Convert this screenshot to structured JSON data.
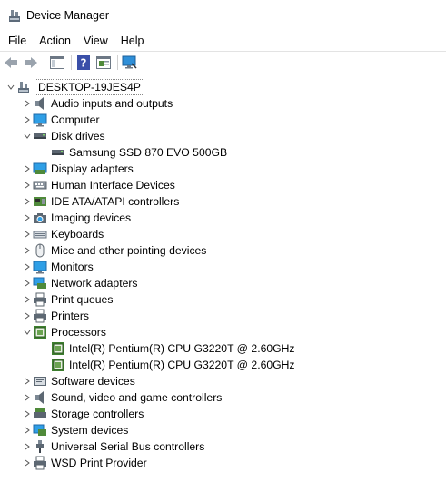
{
  "window": {
    "title": "Device Manager"
  },
  "menu": [
    "File",
    "Action",
    "View",
    "Help"
  ],
  "toolbar": [
    "back-icon",
    "forward-icon",
    "show-hide-console-tree-icon",
    "help-icon",
    "properties-icon",
    "scan-hardware-icon"
  ],
  "tree": {
    "root": "DESKTOP-19JES4P",
    "categories": [
      {
        "label": "Audio inputs and outputs",
        "icon": "speaker-icon",
        "expanded": false
      },
      {
        "label": "Computer",
        "icon": "monitor-icon",
        "expanded": false
      },
      {
        "label": "Disk drives",
        "icon": "disk-drive-icon",
        "expanded": true,
        "children": [
          "Samsung SSD 870 EVO 500GB"
        ]
      },
      {
        "label": "Display adapters",
        "icon": "display-adapter-icon",
        "expanded": false
      },
      {
        "label": "Human Interface Devices",
        "icon": "hid-icon",
        "expanded": false
      },
      {
        "label": "IDE ATA/ATAPI controllers",
        "icon": "ide-controller-icon",
        "expanded": false
      },
      {
        "label": "Imaging devices",
        "icon": "camera-icon",
        "expanded": false
      },
      {
        "label": "Keyboards",
        "icon": "keyboard-icon",
        "expanded": false
      },
      {
        "label": "Mice and other pointing devices",
        "icon": "mouse-icon",
        "expanded": false
      },
      {
        "label": "Monitors",
        "icon": "monitor-icon",
        "expanded": false
      },
      {
        "label": "Network adapters",
        "icon": "network-adapter-icon",
        "expanded": false
      },
      {
        "label": "Print queues",
        "icon": "printer-icon",
        "expanded": false
      },
      {
        "label": "Printers",
        "icon": "printer-icon",
        "expanded": false
      },
      {
        "label": "Processors",
        "icon": "processor-icon",
        "expanded": true,
        "children": [
          "Intel(R) Pentium(R) CPU G3220T @ 2.60GHz",
          "Intel(R) Pentium(R) CPU G3220T @ 2.60GHz"
        ]
      },
      {
        "label": "Software devices",
        "icon": "software-device-icon",
        "expanded": false
      },
      {
        "label": "Sound, video and game controllers",
        "icon": "speaker-icon",
        "expanded": false
      },
      {
        "label": "Storage controllers",
        "icon": "storage-controller-icon",
        "expanded": false
      },
      {
        "label": "System devices",
        "icon": "system-device-icon",
        "expanded": false
      },
      {
        "label": "Universal Serial Bus controllers",
        "icon": "usb-icon",
        "expanded": false
      },
      {
        "label": "WSD Print Provider",
        "icon": "printer-icon",
        "expanded": false
      }
    ]
  }
}
